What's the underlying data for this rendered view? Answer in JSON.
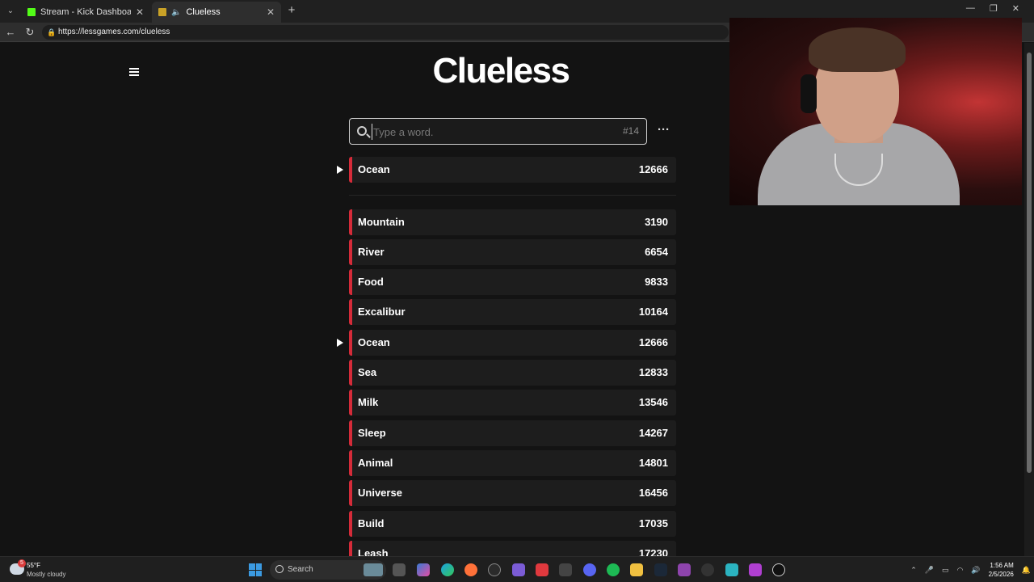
{
  "browser": {
    "tabs": [
      {
        "label": "Stream - Kick Dashboard",
        "icon": "kick-icon"
      },
      {
        "label": "Clueless",
        "icon": "clueless-icon"
      }
    ],
    "url": "https://lessgames.com/clueless"
  },
  "game": {
    "title": "Clueless",
    "search_placeholder": "Type a word.",
    "guess_number": "#14",
    "more_label": "···",
    "latest_guess": {
      "word": "Ocean",
      "rank": "12666"
    },
    "guesses": [
      {
        "word": "Mountain",
        "rank": "3190",
        "current": false
      },
      {
        "word": "River",
        "rank": "6654",
        "current": false
      },
      {
        "word": "Food",
        "rank": "9833",
        "current": false
      },
      {
        "word": "Excalibur",
        "rank": "10164",
        "current": false
      },
      {
        "word": "Ocean",
        "rank": "12666",
        "current": true
      },
      {
        "word": "Sea",
        "rank": "12833",
        "current": false
      },
      {
        "word": "Milk",
        "rank": "13546",
        "current": false
      },
      {
        "word": "Sleep",
        "rank": "14267",
        "current": false
      },
      {
        "word": "Animal",
        "rank": "14801",
        "current": false
      },
      {
        "word": "Universe",
        "rank": "16456",
        "current": false
      },
      {
        "word": "Build",
        "rank": "17035",
        "current": false
      },
      {
        "word": "Leash",
        "rank": "17230",
        "current": false
      }
    ],
    "accent_color": "#d52b39"
  },
  "taskbar": {
    "weather_badge": "5",
    "weather_temp": "55°F",
    "weather_condition": "Mostly cloudy",
    "search_label": "Search",
    "time": "1:56 AM",
    "date": "2/5/2026"
  }
}
